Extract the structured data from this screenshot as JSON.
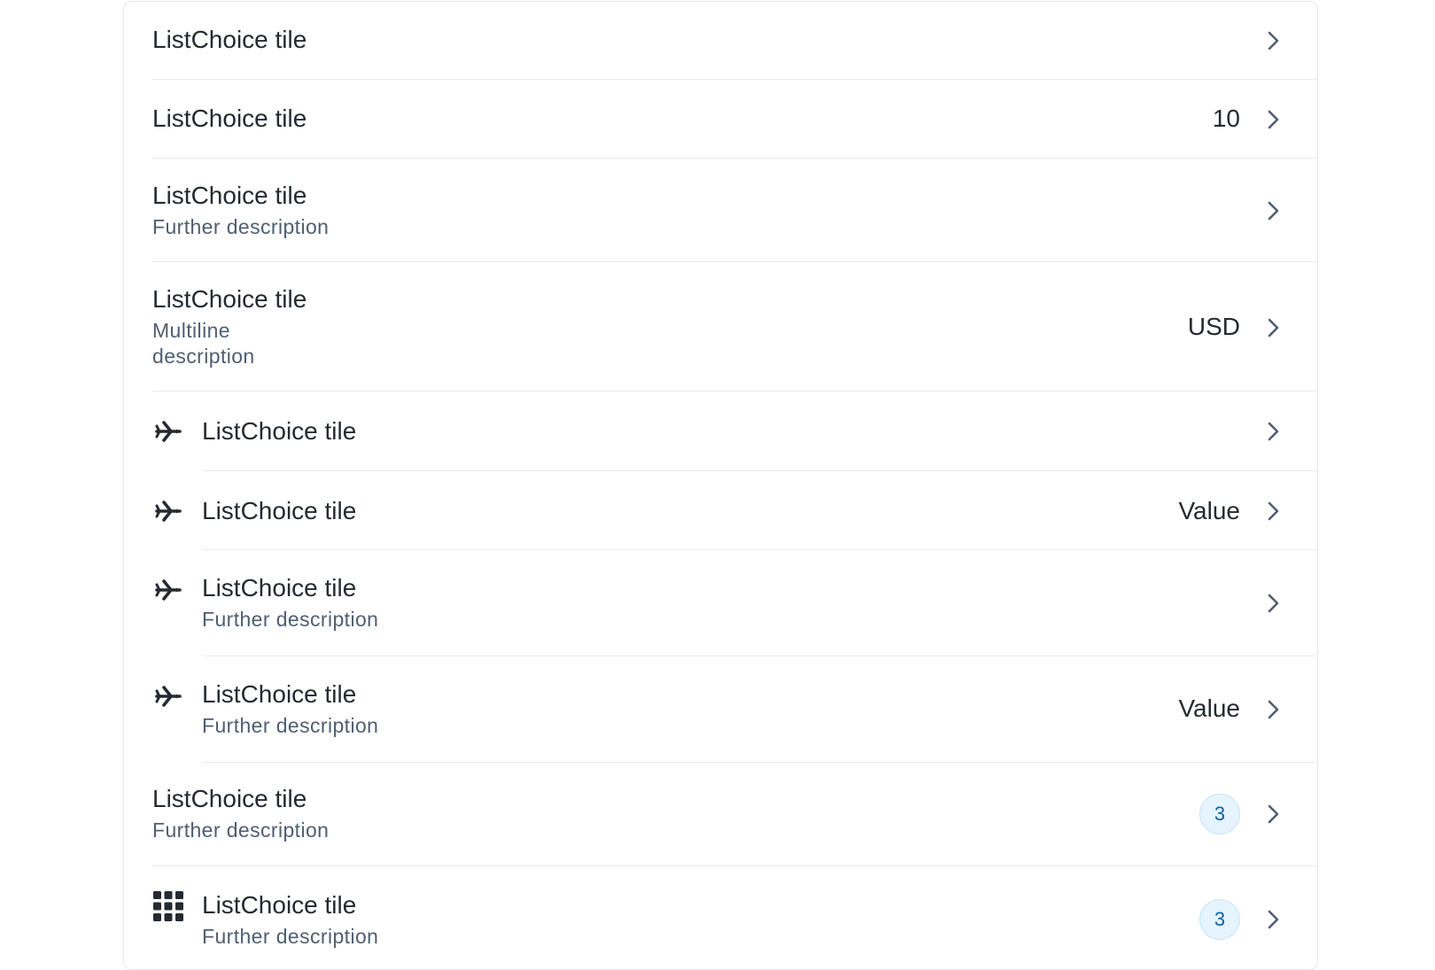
{
  "tiles": [
    {
      "title": "ListChoice tile"
    },
    {
      "title": "ListChoice tile",
      "value": "10"
    },
    {
      "title": "ListChoice tile",
      "description": "Further description"
    },
    {
      "title": "ListChoice tile",
      "description_line1": "Multiline",
      "description_line2": "description",
      "value": "USD"
    },
    {
      "icon": "airplane-icon",
      "title": "ListChoice tile"
    },
    {
      "icon": "airplane-icon",
      "title": "ListChoice tile",
      "value": "Value"
    },
    {
      "icon": "airplane-icon",
      "title": "ListChoice tile",
      "description": "Further description"
    },
    {
      "icon": "airplane-icon",
      "title": "ListChoice tile",
      "description": "Further description",
      "value": "Value"
    },
    {
      "title": "ListChoice tile",
      "description": "Further description",
      "badge": "3"
    },
    {
      "icon": "apps-grid-icon",
      "title": "ListChoice tile",
      "description": "Further description",
      "badge": "3"
    }
  ],
  "colors": {
    "text": "#252a31",
    "secondary_text": "#4f5e71",
    "chevron": "#4f5e71",
    "separator": "#e8ebee",
    "badge_bg": "#e6f4fd",
    "badge_text": "#0a5fa8"
  }
}
